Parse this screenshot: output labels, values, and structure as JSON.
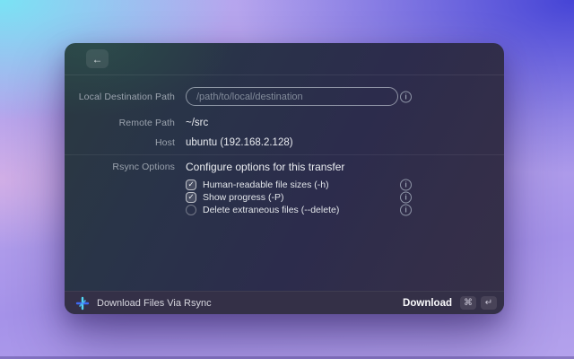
{
  "header": {
    "back_icon": "←"
  },
  "form": {
    "info_icon": "i",
    "rows": [
      {
        "label": "Local Destination Path",
        "placeholder": "/path/to/local/destination"
      },
      {
        "label": "Remote Path",
        "value": "~/src"
      },
      {
        "label": "Host",
        "value": "ubuntu (192.168.2.128)"
      },
      {
        "label": "Rsync Options",
        "value": "Configure options for this transfer"
      }
    ],
    "checkboxes": [
      {
        "label": "Human-readable file sizes (-h)",
        "state": "checked",
        "glyph": "✓"
      },
      {
        "label": "Show progress (-P)",
        "state": "checked",
        "glyph": "✓"
      },
      {
        "label": "Delete extraneous files (--delete)",
        "state": "unchecked",
        "glyph": ""
      }
    ]
  },
  "footer": {
    "command_title": "Download Files Via Rsync",
    "action_label": "Download",
    "keys": [
      "⌘",
      "↵"
    ]
  },
  "colors": {
    "extension_icon_cyan": "#52d4f4",
    "extension_icon_blue": "#3e6af3",
    "window_teal": "#2a3a41",
    "window_indigo": "#2c2c4c",
    "key_badge_bg": "#484358"
  }
}
